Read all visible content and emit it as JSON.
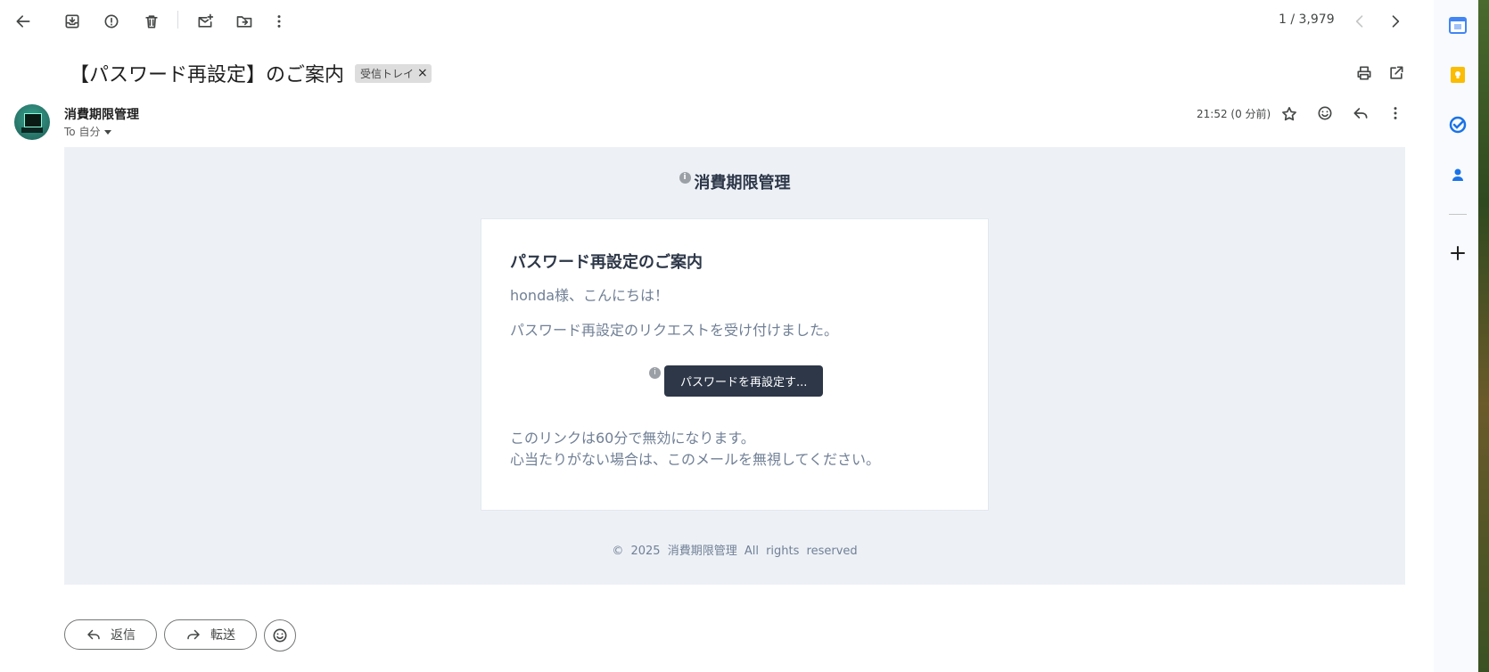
{
  "toolbar": {
    "back_icon": "arrow-left-icon",
    "archive_icon": "archive-icon",
    "report_icon": "report-spam-icon",
    "delete_icon": "trash-icon",
    "mark_unread_icon": "mark-unread-icon",
    "move_icon": "move-to-icon",
    "more_icon": "more-vert-icon",
    "counter": "1 / 3,979"
  },
  "email": {
    "subject": "【パスワード再設定】のご案内",
    "label": "受信トレイ",
    "label_close": "×",
    "sender": "消費期限管理",
    "to": "To 自分",
    "time": "21:52 (0 分前)"
  },
  "body": {
    "brand": "消費期限管理",
    "info_glyph": "i",
    "card_title": "パスワード再設定のご案内",
    "greeting": "honda様、こんにちは！",
    "para1": "パスワード再設定のリクエストを受け付けました。",
    "button": "パスワードを再設定す...",
    "para2_line1": "このリンクは60分で無効になります。",
    "para2_line2": "心当たりがない場合は、このメールを無視してください。",
    "footer": "© 2025 消費期限管理 All rights reserved"
  },
  "actions": {
    "reply": "返信",
    "forward": "転送"
  },
  "colors": {
    "body_bg": "#edf1f6",
    "button_bg": "#2d3748",
    "text_muted": "#718096",
    "heading": "#2d3748"
  }
}
